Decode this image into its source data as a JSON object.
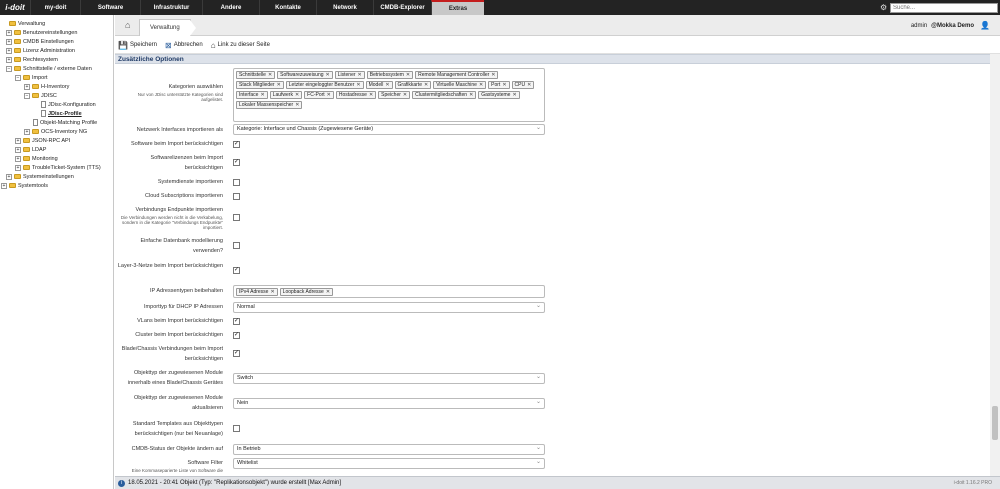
{
  "topbar": {
    "logo": "i-doit",
    "nav": [
      {
        "label": "my-doit"
      },
      {
        "label": "Software"
      },
      {
        "label": "Infrastruktur"
      },
      {
        "label": "Andere"
      },
      {
        "label": "Kontakte"
      },
      {
        "label": "Network"
      },
      {
        "label": "CMDB-Explorer"
      },
      {
        "label": "Extras"
      }
    ],
    "search_placeholder": "Suche..."
  },
  "sidebar": {
    "items": [
      {
        "label": "Verwaltung"
      },
      {
        "label": "Benutzereinstellungen"
      },
      {
        "label": "CMDB Einstellungen"
      },
      {
        "label": "Lizenz Administration"
      },
      {
        "label": "Rechtesystem"
      },
      {
        "label": "Schnittstelle / externe Daten"
      },
      {
        "label": "Import"
      },
      {
        "label": "H-Inventory"
      },
      {
        "label": "JDISC"
      },
      {
        "label": "JDisc-Konfiguration"
      },
      {
        "label": "JDisc-Profile"
      },
      {
        "label": "Objekt-Matching Profile"
      },
      {
        "label": "OCS-Inventory NG"
      },
      {
        "label": "JSON-RPC API"
      },
      {
        "label": "LDAP"
      },
      {
        "label": "Monitoring"
      },
      {
        "label": "TroubleTicket-System (TTS)"
      },
      {
        "label": "Systemeinstellungen"
      },
      {
        "label": "Systemtools"
      }
    ]
  },
  "breadcrumb": {
    "current": "Verwaltung"
  },
  "user": {
    "name": "admin",
    "tenant": "@Mokka Demo"
  },
  "toolbar": {
    "save": "Speichern",
    "cancel": "Abbrechen",
    "link": "Link zu dieser Seite"
  },
  "section_title": "Zusätzliche Optionen",
  "form": {
    "categories": {
      "label": "Kategorien auswählen",
      "sub": "Nur von JDisc unterstützte Kategorien sind aufgelistet.",
      "tags": [
        "Schnittstelle",
        "Softwarezuweisung",
        "Listener",
        "Betriebssystem",
        "Remote Management Controller",
        "Stack Mitglieder",
        "Letzter eingeloggter Benutzer",
        "Modell",
        "Grafikkarte",
        "Virtuelle Maschine",
        "Port",
        "CPU",
        "Interface",
        "Laufwerk",
        "FC-Port",
        "Hostadresse",
        "Speicher",
        "Clustermitgliedschaften",
        "Gastsysteme",
        "Lokaler Massenspeicher"
      ]
    },
    "network_interfaces": {
      "label": "Netzwerk Interfaces importieren als",
      "value": "Kategorie: Interface und Chassis (Zugewiesene Geräte)"
    },
    "software": {
      "label": "Software beim Import berücksichtigen",
      "checked": true
    },
    "licenses": {
      "label": "Softwarelizenzen beim Import berücksichtigen",
      "checked": true
    },
    "services": {
      "label": "Systemdienste importieren",
      "checked": false
    },
    "cloud": {
      "label": "Cloud Subscriptions importieren",
      "checked": false
    },
    "endpoints": {
      "label": "Verbindungs Endpunkte importieren",
      "sub": "Die Verbindungen werden nicht in die Verkabelung, sondern in die Kategorie \"Verbindungs Endpunkte\" importiert.",
      "checked": false
    },
    "database": {
      "label": "Einfache Datenbank modellierung verwenden?",
      "checked": false
    },
    "layer3": {
      "label": "Layer-3-Netze beim Import berücksichtigen",
      "checked": true
    },
    "ip_types": {
      "label": "IP Adressentypen beibehalten",
      "tags": [
        "IPv4 Adresse",
        "Loopback Adresse"
      ]
    },
    "dhcp": {
      "label": "Importtyp für DHCP IP Adressen",
      "value": "Normal"
    },
    "vlans": {
      "label": "VLans beim Import berücksichtigen",
      "checked": true
    },
    "cluster": {
      "label": "Cluster beim Import berücksichtigen",
      "checked": true
    },
    "blade": {
      "label": "Blade/Chassis Verbindungen beim Import berücksichtigen",
      "checked": true
    },
    "module_type": {
      "label": "Objekttyp der zugewiesenen Module innerhalb eines Blade/Chassis Gerätes",
      "value": "Switch"
    },
    "module_update": {
      "label": "Objekttyp der zugewiesenen Module aktualisieren",
      "value": "Nein"
    },
    "templates": {
      "label": "Standard Templates aus Objekttypen berücksichtigen (nur bei Neuanlage)",
      "checked": false
    },
    "cmdb_status": {
      "label": "CMDB-Status der Objekte ändern auf",
      "value": "In Betrieb"
    },
    "sw_filter": {
      "label": "Software Filter",
      "sub": "Eine Kommaseparierte Liste von Software die",
      "value": "Whitelist"
    }
  },
  "statusbar": {
    "message": "18.05.2021 - 20:41 Objekt (Typ: \"Replikationsobjekt\") wurde erstellt [Max Admin]",
    "version": "i-doit 1.16.2 PRO"
  }
}
